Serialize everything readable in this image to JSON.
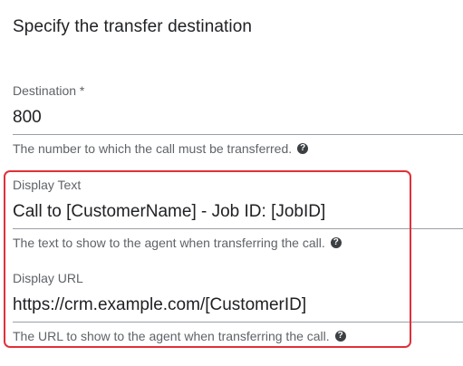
{
  "section": {
    "title": "Specify the transfer destination"
  },
  "fields": {
    "destination": {
      "label": "Destination *",
      "value": "800",
      "help": "The number to which the call must be transferred."
    },
    "display_text": {
      "label": "Display Text",
      "value": "Call to [CustomerName] - Job ID: [JobID]",
      "help": "The text to show to the agent when transferring the call."
    },
    "display_url": {
      "label": "Display URL",
      "value": "https://crm.example.com/[CustomerID]",
      "help": "The URL to show to the agent when transferring the call."
    }
  },
  "icons": {
    "help": "question-circle-icon"
  },
  "colors": {
    "highlight": "#e0313a",
    "text_primary": "#202124",
    "text_secondary": "#5f6368"
  },
  "help_glyph": "?"
}
